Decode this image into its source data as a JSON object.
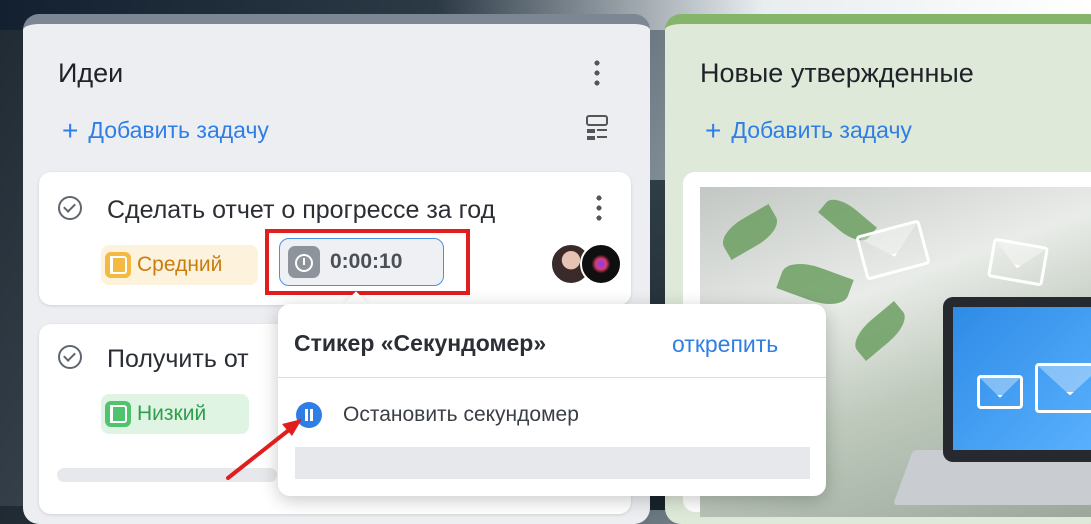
{
  "columns": [
    {
      "title": "Идеи",
      "add_task": "Добавить задачу",
      "cards": [
        {
          "title": "Сделать отчет о прогрессе за год",
          "priority": "Средний",
          "priority_color": "#f4b940",
          "timer": "0:00:10"
        },
        {
          "title": "Получить от",
          "priority": "Низкий",
          "priority_color": "#4fc36d"
        }
      ]
    },
    {
      "title": "Новые утвержденные",
      "add_task": "Добавить задачу"
    }
  ],
  "popup": {
    "title": "Стикер «Секундомер»",
    "unpin": "открепить",
    "stop_label": "Остановить секундомер"
  },
  "colors": {
    "accent": "#2f7ee6",
    "highlight_box": "#e01e1e"
  }
}
